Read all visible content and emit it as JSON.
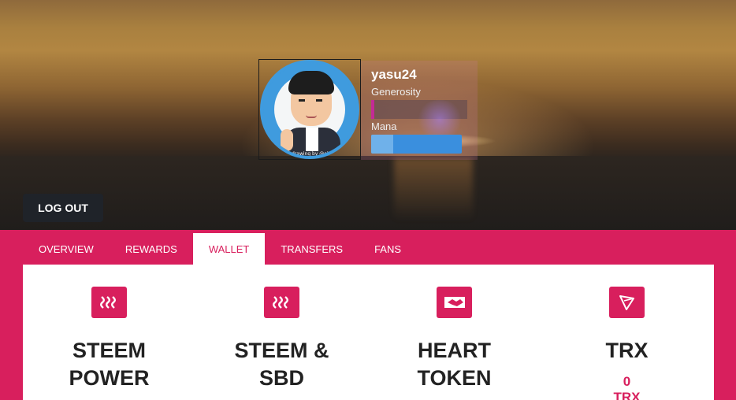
{
  "profile": {
    "username": "yasu24",
    "generosity_label": "Generosity",
    "generosity_level": 0.02,
    "mana_label": "Mana",
    "mana_level": 0.24,
    "avatar_signature": "drawing by @elyzfree"
  },
  "actions": {
    "logout_label": "LOG OUT"
  },
  "tabs": [
    {
      "label": "OVERVIEW",
      "active": false
    },
    {
      "label": "REWARDS",
      "active": false
    },
    {
      "label": "WALLET",
      "active": true
    },
    {
      "label": "TRANSFERS",
      "active": false
    },
    {
      "label": "FANS",
      "active": false
    }
  ],
  "cards": [
    {
      "title_line1": "STEEM",
      "title_line2": "POWER",
      "icon": "steem-icon"
    },
    {
      "title_line1": "STEEM &",
      "title_line2": "SBD",
      "icon": "steem-icon"
    },
    {
      "title_line1": "HEART",
      "title_line2": "TOKEN",
      "icon": "handshake-icon"
    },
    {
      "title_line1": "TRX",
      "amount": "0",
      "unit": "TRX",
      "icon": "tron-icon"
    }
  ],
  "colors": {
    "accent": "#d81f5d",
    "mana": "#3a8fde",
    "generosity": "#c32b95",
    "button": "#1f2329"
  }
}
